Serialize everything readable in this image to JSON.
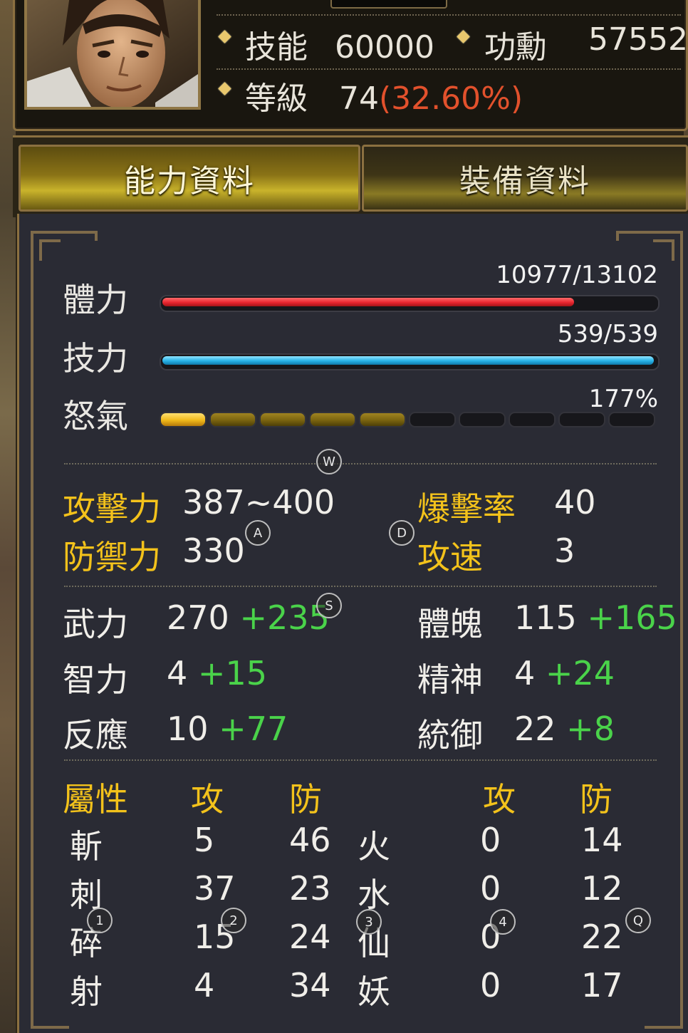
{
  "header": {
    "skill_label": "技能",
    "skill_value": "60000",
    "merit_label": "功勳",
    "merit_value": "57552",
    "level_label": "等級",
    "level_value": "74",
    "level_percent": "(32.60%)"
  },
  "tabs": [
    {
      "label": "能力資料",
      "active": true
    },
    {
      "label": "裝備資料",
      "active": false
    }
  ],
  "bars": {
    "hp": {
      "label": "體力",
      "value": "10977/13102",
      "fraction": 0.8378
    },
    "mp": {
      "label": "技力",
      "value": "539/539",
      "fraction": 1.0
    },
    "rage": {
      "label": "怒氣",
      "value": "177%",
      "filled_segments": 5,
      "total_segments": 10
    }
  },
  "combat": {
    "attack_label": "攻擊力",
    "attack_value": "387~400",
    "defense_label": "防禦力",
    "defense_value": "330",
    "crit_label": "爆擊率",
    "crit_value": "40",
    "speed_label": "攻速",
    "speed_value": "3"
  },
  "attributes": {
    "left": [
      {
        "label": "武力",
        "base": "270",
        "bonus": "+235"
      },
      {
        "label": "智力",
        "base": "4",
        "bonus": "+15"
      },
      {
        "label": "反應",
        "base": "10",
        "bonus": "+77"
      }
    ],
    "right": [
      {
        "label": "體魄",
        "base": "115",
        "bonus": "+165"
      },
      {
        "label": "精神",
        "base": "4",
        "bonus": "+24"
      },
      {
        "label": "統御",
        "base": "22",
        "bonus": "+8"
      }
    ]
  },
  "elements": {
    "header_label": "屬性",
    "atk_header": "攻",
    "def_header": "防",
    "atk_header_2": "攻",
    "def_header_2": "防",
    "rows": [
      {
        "left_name": "斬",
        "left_atk": "5",
        "left_def": "46",
        "right_name": "火",
        "right_atk": "0",
        "right_def": "14"
      },
      {
        "left_name": "刺",
        "left_atk": "37",
        "left_def": "23",
        "right_name": "水",
        "right_atk": "0",
        "right_def": "12"
      },
      {
        "left_name": "碎",
        "left_atk": "15",
        "left_def": "24",
        "right_name": "仙",
        "right_atk": "0",
        "right_def": "22"
      },
      {
        "left_name": "射",
        "left_atk": "4",
        "left_def": "34",
        "right_name": "妖",
        "right_atk": "0",
        "right_def": "17"
      }
    ]
  },
  "key_markers": [
    "W",
    "A",
    "D",
    "S",
    "1",
    "2",
    "3",
    "4",
    "Q"
  ],
  "colors": {
    "gold": "#f3c21b",
    "green": "#4ad34a",
    "hp_red": "#e8262f",
    "mp_blue": "#27b2e6",
    "rage_yellow": "#f0b81a",
    "level_percent_orange": "#e2512c"
  }
}
